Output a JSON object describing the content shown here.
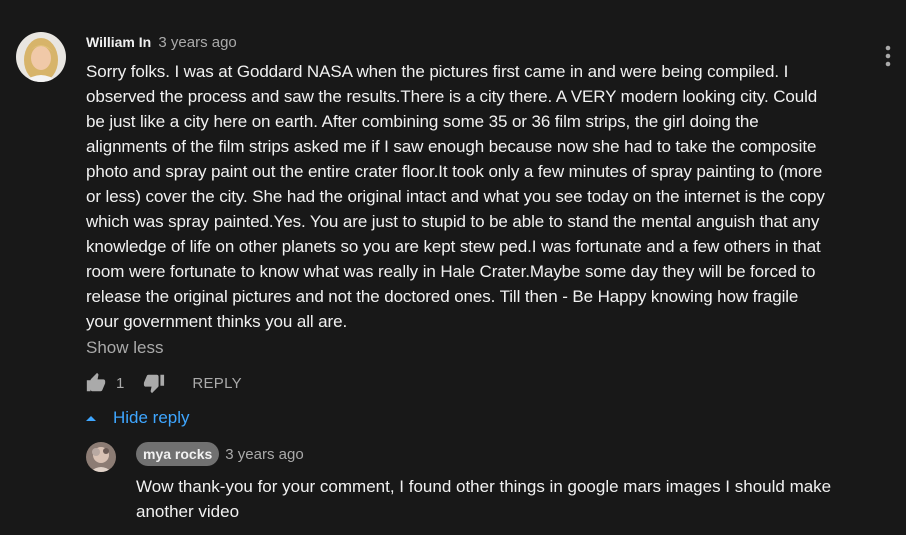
{
  "comment": {
    "author": "William In",
    "time": "3 years ago",
    "lines": [
      "Sorry folks.  I was at Goddard NASA when the pictures first came in and were being compiled.  I",
      "observed the process and saw the results.There is a city there.  A VERY modern looking city.  Could",
      "be just like a city here on earth.  After combining some 35 or 36 film strips, the girl doing the",
      "alignments of the film strips asked me if I saw enough because now she had to take the composite",
      "photo and spray paint out the entire crater floor.It took only a few minutes of spray painting to (more",
      "or less) cover the city.  She had the original intact and what you see today on the internet is the copy",
      "which was spray painted.Yes.  You are just to stupid to be able to stand the mental anguish that any",
      "knowledge of life on other planets so you are kept stew ped.I was fortunate and a few others in that",
      "room were fortunate to know what was really in Hale Crater.Maybe some day they will be forced to",
      "release the original pictures and not the doctored ones.  Till then - Be Happy knowing how fragile",
      "your government thinks you all are."
    ],
    "show_less": "Show less",
    "like_count": "1",
    "reply_label": "REPLY",
    "like_icon": "thumbs-up-icon",
    "dislike_icon": "thumbs-down-icon",
    "menu_icon": "more-vert-icon"
  },
  "replies_toggle": {
    "label": "Hide reply",
    "icon": "caret-up-icon",
    "color": "#3ea6ff"
  },
  "reply": {
    "author": "mya rocks",
    "time": "3 years ago",
    "lines": [
      "Wow thank-you for your comment, I found other things in google mars images I should make",
      "another video"
    ]
  },
  "colors": {
    "background": "#181818",
    "text": "#f1f1f1",
    "secondary": "#aaaaaa",
    "badge": "#717171"
  }
}
